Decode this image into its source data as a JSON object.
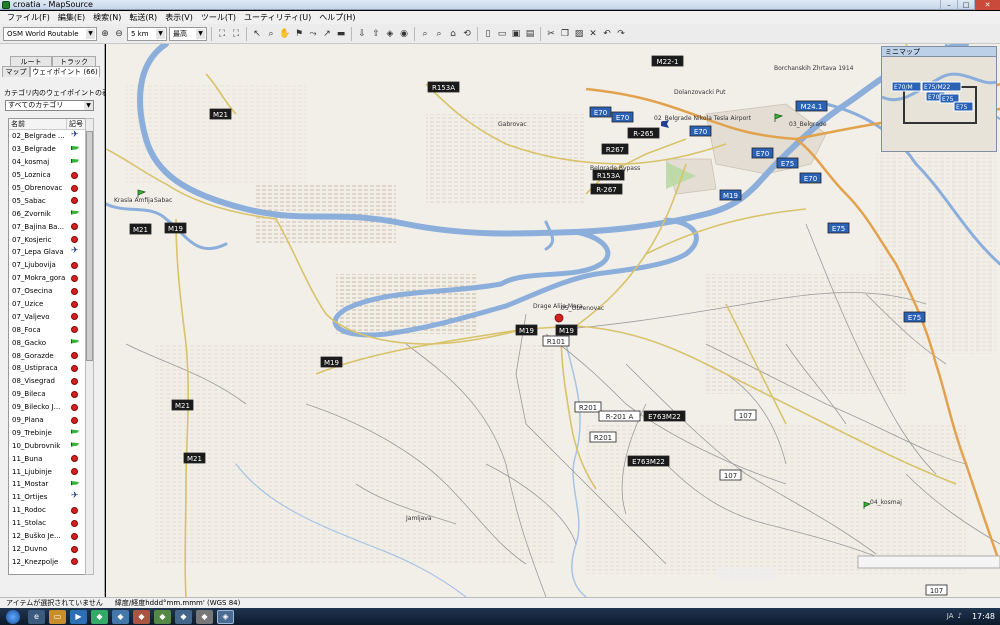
{
  "window": {
    "title": "croatia - MapSource",
    "controls": [
      "–",
      "□",
      "✕"
    ]
  },
  "menu": [
    "ファイル(F)",
    "編集(E)",
    "検索(N)",
    "転送(R)",
    "表示(V)",
    "ツール(T)",
    "ユーティリティ(U)",
    "ヘルプ(H)"
  ],
  "toolbar": {
    "map_product": "OSM World Routable",
    "scale": "5 km",
    "detail": "最高"
  },
  "panel": {
    "tabs": [
      "ルート",
      "トラック",
      "マップ",
      "ウェイポイント (66)"
    ],
    "category_label": "カテゴリ内のウェイポイントの表",
    "category_value": "すべてのカテゴリ",
    "col_name": "名前",
    "col_symbol": "記号",
    "waypoints": [
      {
        "name": "02_Belgrade ...",
        "symbol": "plane"
      },
      {
        "name": "03_Belgrade",
        "symbol": "flag"
      },
      {
        "name": "04_kosmaj",
        "symbol": "flag"
      },
      {
        "name": "05_Loznica",
        "symbol": "pin"
      },
      {
        "name": "05_Obrenovac",
        "symbol": "pin"
      },
      {
        "name": "05_Sabac",
        "symbol": "pin"
      },
      {
        "name": "06_Zvornik",
        "symbol": "flag"
      },
      {
        "name": "07_Bajina Ba...",
        "symbol": "pin"
      },
      {
        "name": "07_Kosjeric",
        "symbol": "pin"
      },
      {
        "name": "07_Lepa Glava",
        "symbol": "plane"
      },
      {
        "name": "07_Ljubovija",
        "symbol": "pin"
      },
      {
        "name": "07_Mokra_gora",
        "symbol": "pin"
      },
      {
        "name": "07_Osecina",
        "symbol": "pin"
      },
      {
        "name": "07_Uzice",
        "symbol": "pin"
      },
      {
        "name": "07_Valjevo",
        "symbol": "pin"
      },
      {
        "name": "08_Foca",
        "symbol": "pin"
      },
      {
        "name": "08_Gacko",
        "symbol": "flag"
      },
      {
        "name": "08_Gorazde",
        "symbol": "pin"
      },
      {
        "name": "08_Ustipraca",
        "symbol": "pin"
      },
      {
        "name": "08_Visegrad",
        "symbol": "pin"
      },
      {
        "name": "09_Bileca",
        "symbol": "pin"
      },
      {
        "name": "09_Bilecko J...",
        "symbol": "pin"
      },
      {
        "name": "09_Plana",
        "symbol": "pin"
      },
      {
        "name": "09_Trebinje",
        "symbol": "flag"
      },
      {
        "name": "10_Dubrovnik",
        "symbol": "flag"
      },
      {
        "name": "11_Buna",
        "symbol": "pin"
      },
      {
        "name": "11_Ljubinje",
        "symbol": "pin"
      },
      {
        "name": "11_Mostar",
        "symbol": "flag"
      },
      {
        "name": "11_Ortijes",
        "symbol": "plane"
      },
      {
        "name": "11_Rodoc",
        "symbol": "pin"
      },
      {
        "name": "11_Stolac",
        "symbol": "pin"
      },
      {
        "name": "12_Buško Je...",
        "symbol": "pin"
      },
      {
        "name": "12_Duvno",
        "symbol": "pin"
      },
      {
        "name": "12_Knezpolje",
        "symbol": "pin"
      }
    ]
  },
  "map": {
    "road_labels": [
      "M22-1",
      "R153A",
      "E70",
      "E70",
      "E70",
      "M24.1",
      "M21",
      "R267",
      "R-265",
      "R153A",
      "R-267",
      "M19",
      "E70",
      "E75",
      "E70",
      "E75",
      "M19",
      "M21",
      "M19",
      "M19",
      "R101",
      "M19",
      "E75",
      "M21",
      "M21",
      "R201",
      "R-201 A",
      "E763M22",
      "R201",
      "E763M22",
      "107",
      "107",
      "107"
    ],
    "place_labels": [
      "Borchanskih Zhrtava 1914",
      "Dolanzovacki Put",
      "02_Belgrade Nikola Tesla Airport",
      "03_Belgrade",
      "Belgrade Bypass",
      "Krasla Amfija",
      "Sabac",
      "Drage Alija Mara",
      "05_Obrenovac",
      "04_kosmaj",
      "Gabrovac",
      "Jamljava"
    ],
    "minimap_title": "ミニマップ",
    "minimap_labels": [
      "E70/M",
      "E75/M22",
      "E70",
      "E75",
      "E75"
    ]
  },
  "status": {
    "selection": "アイテムが選択されていません",
    "coords": "緯度/経度hddd°mm.mmm' (WGS 84)"
  },
  "taskbar": {
    "clock": "17:48",
    "tray": "JA"
  }
}
